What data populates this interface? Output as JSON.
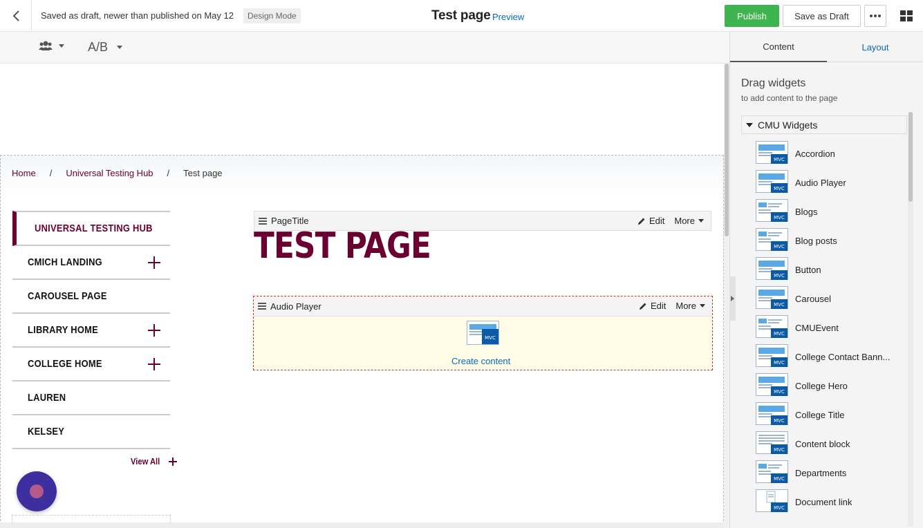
{
  "topbar": {
    "draft_status": "Saved as draft, newer than published on May 12",
    "mode_badge": "Design Mode",
    "page_title": "Test page",
    "preview_label": "Preview",
    "publish_label": "Publish",
    "save_draft_label": "Save as Draft"
  },
  "toolbar": {
    "ab_label": "A/B"
  },
  "breadcrumb": {
    "home": "Home",
    "hub": "Universal Testing Hub",
    "current": "Test page",
    "separator": "/"
  },
  "leftnav": {
    "header": "UNIVERSAL TESTING HUB",
    "items": [
      {
        "label": "CMICH LANDING",
        "expandable": true
      },
      {
        "label": "CAROUSEL PAGE",
        "expandable": false
      },
      {
        "label": "LIBRARY HOME",
        "expandable": true
      },
      {
        "label": "COLLEGE HOME",
        "expandable": true
      },
      {
        "label": "LAUREN",
        "expandable": false
      },
      {
        "label": "KELSEY",
        "expandable": false
      }
    ],
    "view_all": "View All"
  },
  "widgets": {
    "page_title_widget": "PageTitle",
    "audio_widget": "Audio Player",
    "edit_label": "Edit",
    "more_label": "More",
    "big_title": "TEST PAGE",
    "create_content": "Create content",
    "mvc_badge": "MVC"
  },
  "rightpanel": {
    "tab_content": "Content",
    "tab_layout": "Layout",
    "heading": "Drag widgets",
    "subheading": "to add content to the page",
    "group": "CMU Widgets",
    "items": [
      {
        "label": "Accordion",
        "icon": "banner"
      },
      {
        "label": "Audio Player",
        "icon": "banner"
      },
      {
        "label": "Blogs",
        "icon": "list"
      },
      {
        "label": "Blog posts",
        "icon": "list"
      },
      {
        "label": "Button",
        "icon": "banner"
      },
      {
        "label": "Carousel",
        "icon": "banner"
      },
      {
        "label": "CMUEvent",
        "icon": "list"
      },
      {
        "label": "College Contact Bann...",
        "icon": "banner"
      },
      {
        "label": "College Hero",
        "icon": "banner"
      },
      {
        "label": "College Title",
        "icon": "banner"
      },
      {
        "label": "Content block",
        "icon": "text"
      },
      {
        "label": "Departments",
        "icon": "list"
      },
      {
        "label": "Document link",
        "icon": "doc"
      }
    ]
  },
  "colors": {
    "brand_maroon": "#6a0032",
    "publish_green": "#3fb44f",
    "link_blue": "#0a68b4",
    "fab_purple": "#3d2fa0"
  }
}
